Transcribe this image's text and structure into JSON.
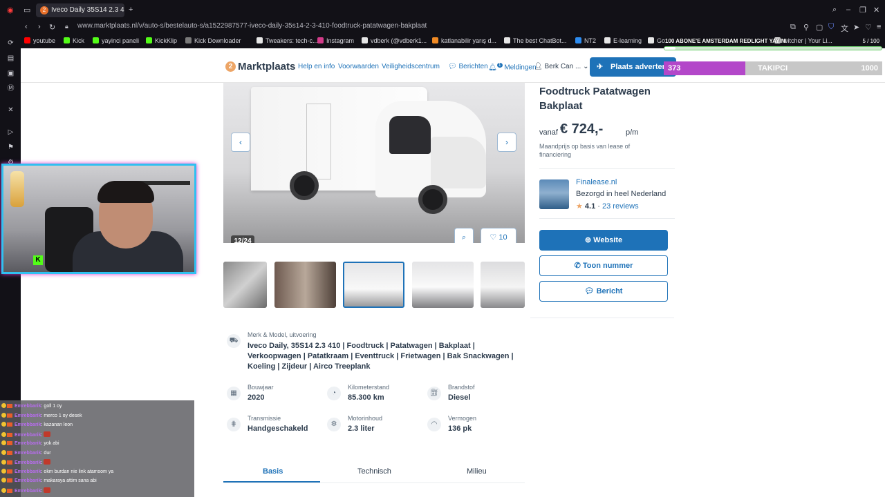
{
  "browser": {
    "tab_title": "Iveco Daily 35S14 2.3 41",
    "tab_badge": "2",
    "url": "www.marktplaats.nl/v/auto-s/bestelauto-s/a1522987577-iveco-daily-35s14-2-3-410-foodtruck-patatwagen-bakplaat",
    "bookmarks": [
      {
        "label": "youtube",
        "color": "#ff0000"
      },
      {
        "label": "Kick",
        "color": "#53fc18"
      },
      {
        "label": "yayinci paneli",
        "color": "#53fc18"
      },
      {
        "label": "KickKlip",
        "color": "#53fc18"
      },
      {
        "label": "Kick Downloader",
        "color": "#7a7a7a"
      },
      {
        "label": "Tweakers: tech-c...",
        "color": "#e6e6e6"
      },
      {
        "label": "Instagram",
        "color": "#d43b8a"
      },
      {
        "label": "vdberk (@vdberk1...",
        "color": "#e6e6e6"
      },
      {
        "label": "katlanabilir yarış d...",
        "color": "#f08a24"
      },
      {
        "label": "The best ChatBot...",
        "color": "#e6e6e6"
      },
      {
        "label": "NT2",
        "color": "#2d8cf0"
      },
      {
        "label": "E-learning",
        "color": "#e6e6e6"
      },
      {
        "label": "Go...",
        "color": "#e6e6e6"
      },
      {
        "label": "witcher | Your Li...",
        "color": "#e6e6e6"
      }
    ]
  },
  "site": {
    "logo_badge": "2",
    "logo": "Marktplaats",
    "nav": {
      "help": "Help en info",
      "conditions": "Voorwaarden",
      "safety": "Veiligheidscentrum",
      "messages": "Berichten",
      "notifications": "Meldingen",
      "notifications_count": "1",
      "user": "Berk Can ...",
      "post_ad": "Plaats advertentie"
    }
  },
  "listing": {
    "title": "Foodtruck Patatwagen Bakplaat",
    "price_prefix": "vanaf",
    "price": "€ 724,-",
    "price_suffix": "p/m",
    "price_note": "Maandprijs op basis van lease of financiering",
    "image_counter": "12/24",
    "favorites": "10",
    "dealer": {
      "name": "Finalease.nl",
      "subtitle": "Bezorgd in heel Nederland",
      "rating": "4.1",
      "reviews": "23 reviews"
    },
    "buttons": {
      "website": "Website",
      "phone": "Toon nummer",
      "message": "Bericht"
    },
    "model_label": "Merk & Model, uitvoering",
    "model_value": "Iveco Daily, 35S14 2.3 410 | Foodtruck | Patatwagen | Bakplaat | Verkoopwagen | Patatkraam | Eventtruck | Frietwagen | Bak Snackwagen | Koeling | Zijdeur | Airco Treeplank",
    "specs": [
      {
        "label": "Bouwjaar",
        "value": "2020",
        "icon": "calendar-icon"
      },
      {
        "label": "Kilometerstand",
        "value": "85.300 km",
        "icon": "odometer-icon"
      },
      {
        "label": "Brandstof",
        "value": "Diesel",
        "icon": "fuel-icon"
      },
      {
        "label": "Transmissie",
        "value": "Handgeschakeld",
        "icon": "gearbox-icon"
      },
      {
        "label": "Motorinhoud",
        "value": "2.3 liter",
        "icon": "engine-icon"
      },
      {
        "label": "Vermogen",
        "value": "136 pk",
        "icon": "gauge-icon"
      }
    ],
    "tabs": [
      {
        "label": "Basis",
        "active": true
      },
      {
        "label": "Technisch",
        "active": false
      },
      {
        "label": "Milieu",
        "active": false
      }
    ]
  },
  "overlay": {
    "goal_title": "100 ABONE'E AMSTERDAM REDLIGHT YAYINI",
    "goal_count": "5 / 100",
    "goal_progress": 0.05,
    "follow_current": "373",
    "follow_label": "TAKIPCI",
    "follow_target": "1000",
    "follow_progress": 0.373,
    "chat": [
      {
        "user": "Emrebbarik",
        "msg": "goll 1 oy"
      },
      {
        "user": "Emrebbarik",
        "msg": "merco 1 oy desek"
      },
      {
        "user": "Emrebbarik",
        "msg": "kazanan leon"
      },
      {
        "user": "Emrebbarik",
        "msg": ""
      },
      {
        "user": "Emrebbarik",
        "msg": "yok abi"
      },
      {
        "user": "Emrebbarik",
        "msg": "dur"
      },
      {
        "user": "Emrebbarik",
        "msg": ""
      },
      {
        "user": "Emrebbarik",
        "msg": "okm burdan nie link atamsom ya"
      },
      {
        "user": "Emrebbarik",
        "msg": "makaraya attim sana abi"
      },
      {
        "user": "Emrebbarik",
        "msg": ""
      }
    ]
  },
  "colors": {
    "accent": "#1e72b8",
    "text_dark": "#2d3c4d",
    "logo_orange": "#eda566"
  }
}
